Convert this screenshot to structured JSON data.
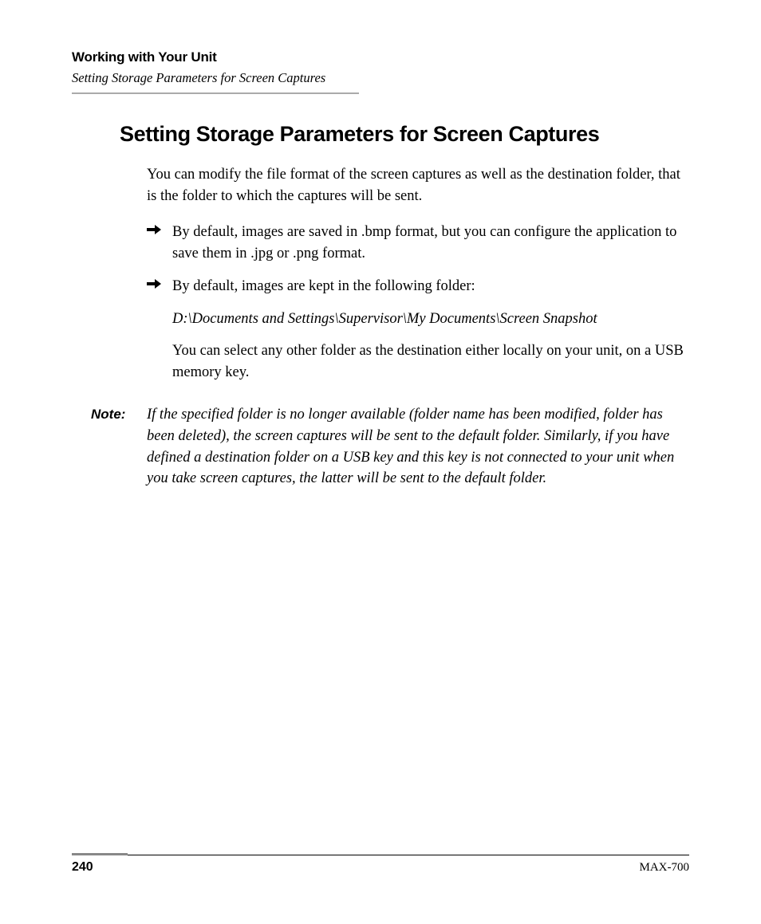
{
  "header": {
    "chapter": "Working with Your Unit",
    "section": "Setting Storage Parameters for Screen Captures"
  },
  "main": {
    "heading": "Setting Storage Parameters for Screen Captures",
    "intro": "You can modify the file format of the screen captures as well as the destination folder, that is the folder to which the captures will be sent.",
    "bullets": [
      {
        "paragraphs": [
          "By default, images are saved in .bmp format, but you can configure the application to save them in .jpg or .png format."
        ]
      },
      {
        "paragraphs": [
          "By default, images are kept in the following folder:",
          "D:\\Documents and Settings\\Supervisor\\My Documents\\Screen Snapshot",
          "You can select any other folder as the destination either locally on your unit, on a USB memory key."
        ],
        "italic_index": 1
      }
    ],
    "note_label": "Note:",
    "note_text": "If the specified folder is no longer available (folder name has been modified, folder has been deleted), the screen captures will be sent to the default folder. Similarly, if you have defined a destination folder on a USB key and this key is not connected to your unit when you take screen captures, the latter will be sent to the default folder."
  },
  "footer": {
    "page_number": "240",
    "product": "MAX-700"
  }
}
